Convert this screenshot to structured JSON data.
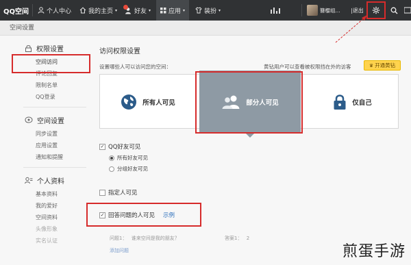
{
  "topbar": {
    "logo": "QQ空间",
    "personal_center": "个人中心",
    "my_homepage": "我的主页",
    "friends": "好友",
    "apps": "应用",
    "dressup": "装扮",
    "username": "簪樱组...",
    "logout": "|退出"
  },
  "crumb": "空间设置",
  "sidebar": {
    "sections": [
      {
        "title": "权限设置",
        "items": [
          "空间访问",
          "评论回复",
          "限制名单",
          "QQ登录"
        ]
      },
      {
        "title": "空间设置",
        "items": [
          "同步设置",
          "应用设置",
          "通知和提醒"
        ]
      },
      {
        "title": "个人资料",
        "items": [
          "基本资料",
          "我的爱好",
          "空间资料",
          "头像形象",
          "实名认证"
        ]
      }
    ]
  },
  "main": {
    "title": "访问权限设置",
    "desc": "设置哪些人可以访问您的空间：",
    "yellow_note": "黄钻用户可以查看被权限挡在外的访客",
    "open_btn": "开通黄钻",
    "cards": [
      {
        "label": "所有人可见",
        "icon": "globe-icon"
      },
      {
        "label": "部分人可见",
        "icon": "people-icon"
      },
      {
        "label": "仅自己",
        "icon": "lock-icon"
      }
    ],
    "qq_friends": "QQ好友可见",
    "all_friends": "所有好友可见",
    "group_friends": "分组好友可见",
    "specific": "指定人可见",
    "answer_question": "回答问题的人可见",
    "example": "示例",
    "question_label": "问题1：",
    "question_text": "谁来空间是我的朋友？",
    "answer_label": "答案1：",
    "answer_text": "2",
    "add_question": "添加问题"
  },
  "watermark": "煎蛋手游",
  "colors": {
    "topbar": "#303234",
    "selected_card": "#8e9aa4",
    "highlight": "#d62b2b",
    "vip_yellow": "#ffd34e"
  }
}
